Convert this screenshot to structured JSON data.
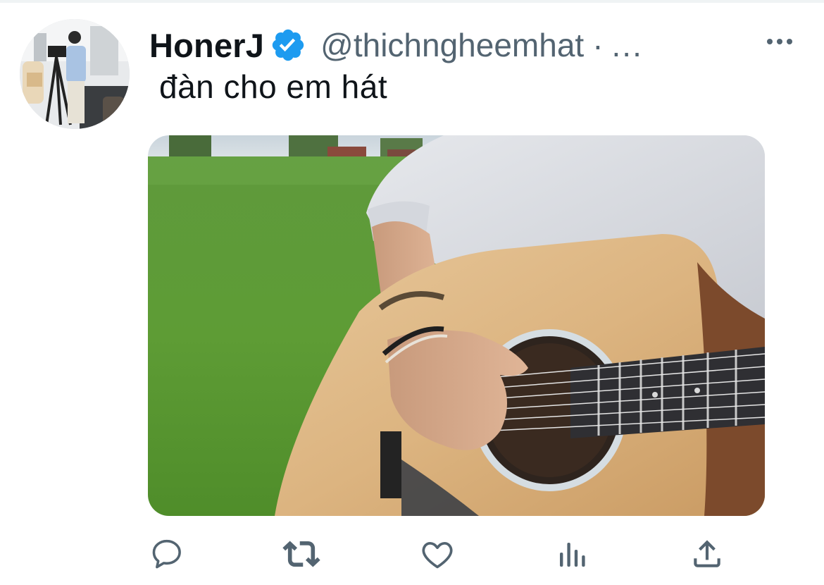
{
  "tweet": {
    "display_name": "HonerJ",
    "verified": true,
    "handle": "@thichngheemhat",
    "separator": "·",
    "truncation": "...",
    "text": "đàn cho em hát",
    "more_icon": "more-horizontal-icon"
  },
  "media": {
    "type": "photo",
    "icon": "photo"
  },
  "actions": [
    {
      "name": "reply",
      "icon": "reply-icon"
    },
    {
      "name": "retweet",
      "icon": "retweet-icon"
    },
    {
      "name": "like",
      "icon": "heart-icon"
    },
    {
      "name": "analytics",
      "icon": "analytics-icon"
    },
    {
      "name": "share",
      "icon": "share-icon"
    }
  ],
  "colors": {
    "text_primary": "#0f1419",
    "text_secondary": "#536471",
    "verified_blue": "#1d9bf0",
    "icon_gray": "#536471"
  }
}
